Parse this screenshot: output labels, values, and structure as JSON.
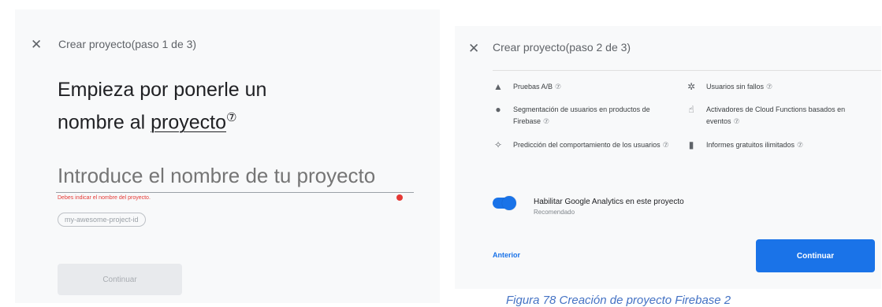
{
  "step1": {
    "close_icon": "close-icon",
    "title": "Crear proyecto(paso 1 de 3)",
    "heading_line1": "Empieza por ponerle un",
    "heading_prefix2": "nombre al ",
    "heading_link": "proyecto",
    "help_glyph": "⑦",
    "input_placeholder": "Introduce el nombre de tu proyecto",
    "error_message": "Debes indicar el nombre del proyecto.",
    "project_id": "my-awesome-project-id",
    "continue_label": "Continuar"
  },
  "step2": {
    "close_icon": "close-icon",
    "title": "Crear proyecto(paso 2 de 3)",
    "help_glyph": "⑦",
    "features": [
      {
        "label": "Pruebas A/B",
        "icon": "flask-icon"
      },
      {
        "label": "Usuarios sin fallos",
        "icon": "crashlytics-icon"
      },
      {
        "label": "Segmentación de usuarios en productos de Firebase",
        "icon": "users-icon"
      },
      {
        "label": "Activadores de Cloud Functions basados en eventos",
        "icon": "touch-icon"
      },
      {
        "label": "Predicción del comportamiento de los usuarios",
        "icon": "magic-wand-icon"
      },
      {
        "label": "Informes gratuitos ilimitados",
        "icon": "bar-chart-icon"
      }
    ],
    "analytics_toggle_on": true,
    "analytics_label": "Habilitar Google Analytics en este proyecto",
    "analytics_sublabel": "Recomendado",
    "back_label": "Anterior",
    "continue_label": "Continuar"
  },
  "caption": "Figura 78 Creación de proyecto Firebase 2",
  "colors": {
    "primary": "#1a73e8",
    "error": "#e53935",
    "caption": "#4472c4"
  }
}
